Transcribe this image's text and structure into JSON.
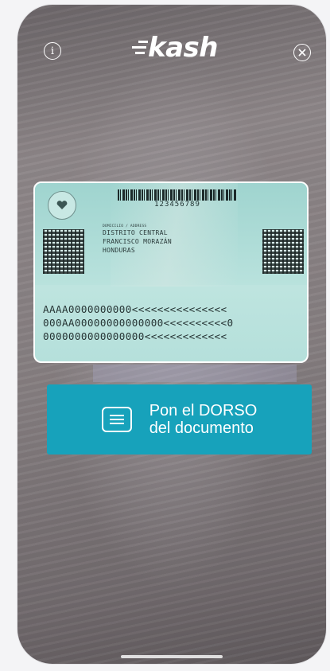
{
  "header": {
    "logo_text": "kash",
    "info_icon": "info-icon",
    "close_icon": "close-icon"
  },
  "id_card": {
    "barcode_number": "123456789",
    "address_label": "DOMICILIO / ADDRESS",
    "address_lines": [
      "DISTRITO CENTRAL",
      "FRANCISCO MORAZÁN",
      "HONDURAS"
    ],
    "mrz_lines": [
      "AAAA0000000000<<<<<<<<<<<<<<<",
      "000AA00000000000000<<<<<<<<<<0",
      "0000000000000000<<<<<<<<<<<<<"
    ]
  },
  "instruction": {
    "icon": "document-icon",
    "line1": "Pon el DORSO",
    "line2": "del documento"
  },
  "colors": {
    "accent": "#17a2bb",
    "card": "#b5e0db"
  }
}
